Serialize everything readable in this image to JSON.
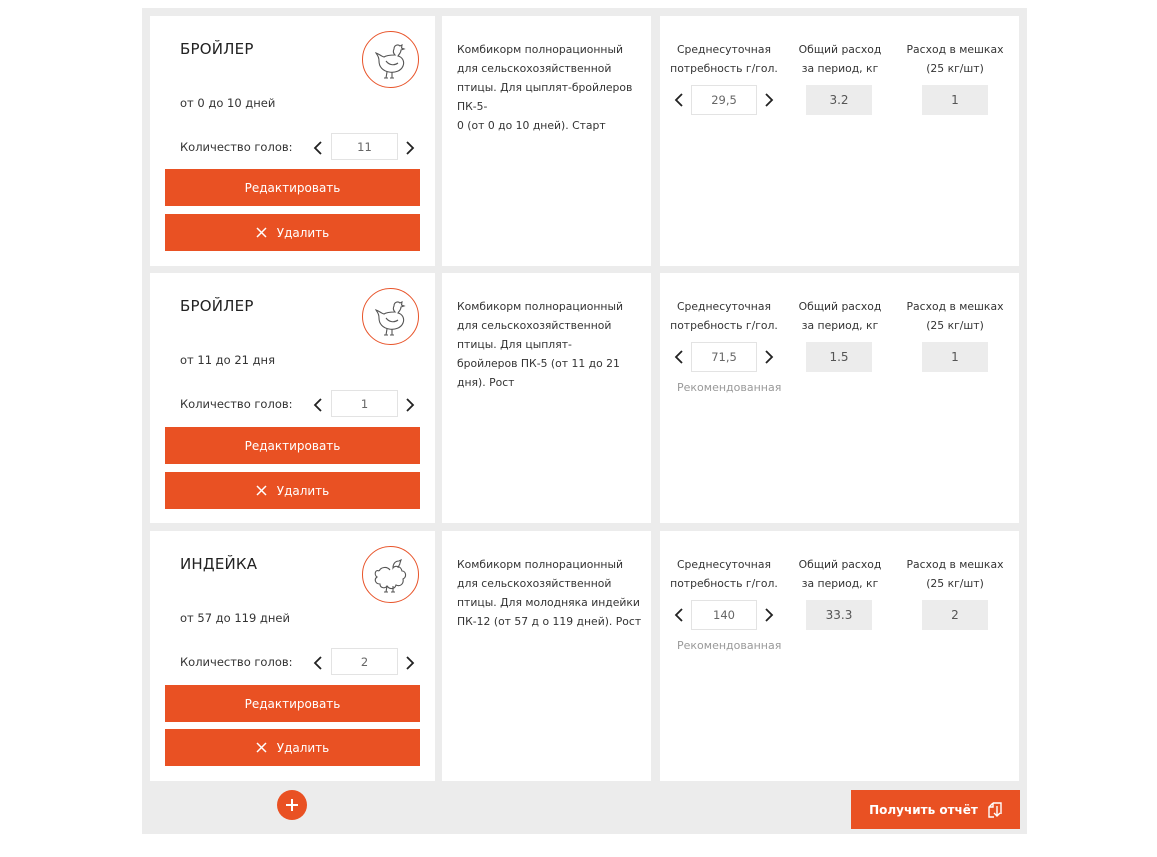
{
  "rows": [
    {
      "title": "БРОЙЛЕР",
      "age": "от 0 до 10 дней",
      "bird_icon": "chicken-icon",
      "heads_label": "Количество голов:",
      "heads": "11",
      "edit_label": "Редактировать",
      "delete_label": "Удалить",
      "description": "Комбикорм полнорационный для сельскохозяйственной птицы. Для цыплят-бройлеров ПК-5-\n0 (от 0 до 10 дней). Старт",
      "daily_head": "Среднесуточная\nпотребность г/гол.",
      "daily_value": "29,5",
      "recommended": "",
      "total_head": "Общий расход\nза период, кг",
      "total_value": "3.2",
      "bags_head": "Расход в мешках\n(25 кг/шт)",
      "bags_value": "1"
    },
    {
      "title": "БРОЙЛЕР",
      "age": "от 11 до 21 дня",
      "bird_icon": "chicken-icon",
      "heads_label": "Количество голов:",
      "heads": "1",
      "edit_label": "Редактировать",
      "delete_label": "Удалить",
      "description": "Комбикорм полнорационный для сельскохозяйственной птицы. Для цыплят-\nбройлеров ПК-5 (от 11 до 21 дня). Рост",
      "daily_head": "Среднесуточная\nпотребность г/гол.",
      "daily_value": "71,5",
      "recommended": "Рекомендованная",
      "total_head": "Общий расход\nза период, кг",
      "total_value": "1.5",
      "bags_head": "Расход в мешках\n(25 кг/шт)",
      "bags_value": "1"
    },
    {
      "title": "ИНДЕЙКА",
      "age": "от 57 до 119 дней",
      "bird_icon": "turkey-icon",
      "heads_label": "Количество голов:",
      "heads": "2",
      "edit_label": "Редактировать",
      "delete_label": "Удалить",
      "description": "Комбикорм полнорационный для сельскохозяйственной птицы. Для молодняка индейки ПК-12 (от 57 д о 119 дней). Рост",
      "daily_head": "Среднесуточная\nпотребность г/гол.",
      "daily_value": "140",
      "recommended": "Рекомендованная",
      "total_head": "Общий расход\nза период, кг",
      "total_value": "33.3",
      "bags_head": "Расход в мешках\n(25 кг/шт)",
      "bags_value": "2"
    }
  ],
  "footer": {
    "add_icon": "plus-icon",
    "report_label": "Получить отчёт",
    "report_icon": "download-document-icon"
  },
  "colors": {
    "accent": "#e95123",
    "panel_bg": "#ececec",
    "value_bg": "#ececec"
  }
}
